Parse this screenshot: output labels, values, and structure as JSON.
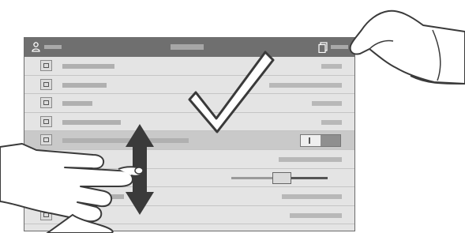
{
  "header": {
    "user_label": "",
    "title": "",
    "copy_label": "",
    "user_icon": "user-icon",
    "copy_icon": "copy-icon"
  },
  "rows": [
    {
      "name": "row-1",
      "icon": "document-icon"
    },
    {
      "name": "row-2",
      "icon": "list-icon"
    },
    {
      "name": "row-3",
      "icon": "copies-icon"
    },
    {
      "name": "row-4",
      "icon": "color-icon"
    },
    {
      "name": "row-5",
      "icon": "diamond-icon",
      "control": "toggle"
    },
    {
      "name": "row-6",
      "icon": "none"
    },
    {
      "name": "row-7",
      "icon": "none",
      "control": "slider"
    },
    {
      "name": "row-8",
      "icon": "none"
    },
    {
      "name": "row-9",
      "icon": "grid-icon"
    }
  ],
  "indicators": {
    "confirm": "checkmark-icon",
    "scroll": "double-arrow-vertical-icon",
    "scroll_hand": "hand-swipe-icon",
    "tap_hand": "hand-tap-icon"
  },
  "colors": {
    "header": "#6f6f6f",
    "screen": "#e4e4e4",
    "ink": "#3a3a3a"
  }
}
